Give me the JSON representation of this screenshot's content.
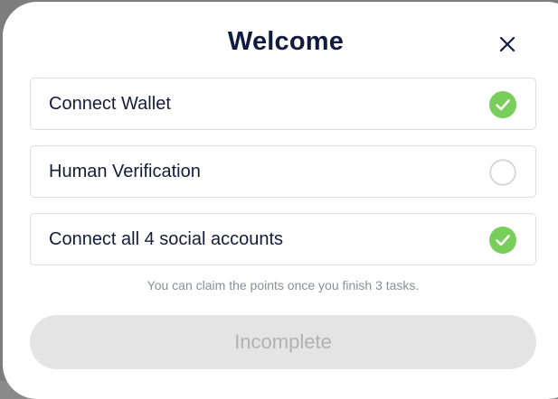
{
  "modal": {
    "title": "Welcome",
    "close_icon": "close-icon"
  },
  "tasks": [
    {
      "label": "Connect Wallet",
      "status": "complete",
      "icon": "check-circle-icon"
    },
    {
      "label": "Human Verification",
      "status": "incomplete",
      "icon": "empty-circle-icon"
    },
    {
      "label": "Connect all 4 social accounts",
      "status": "complete",
      "icon": "check-circle-icon"
    }
  ],
  "hint_text": "You can claim the points once you finish 3 tasks.",
  "submit_label": "Incomplete",
  "colors": {
    "check_green": "#79cd5a",
    "title_text": "#111b3d",
    "button_bg_disabled": "#e4e4e4",
    "button_text_disabled": "#b1b1b1",
    "border": "#dcdde2"
  }
}
